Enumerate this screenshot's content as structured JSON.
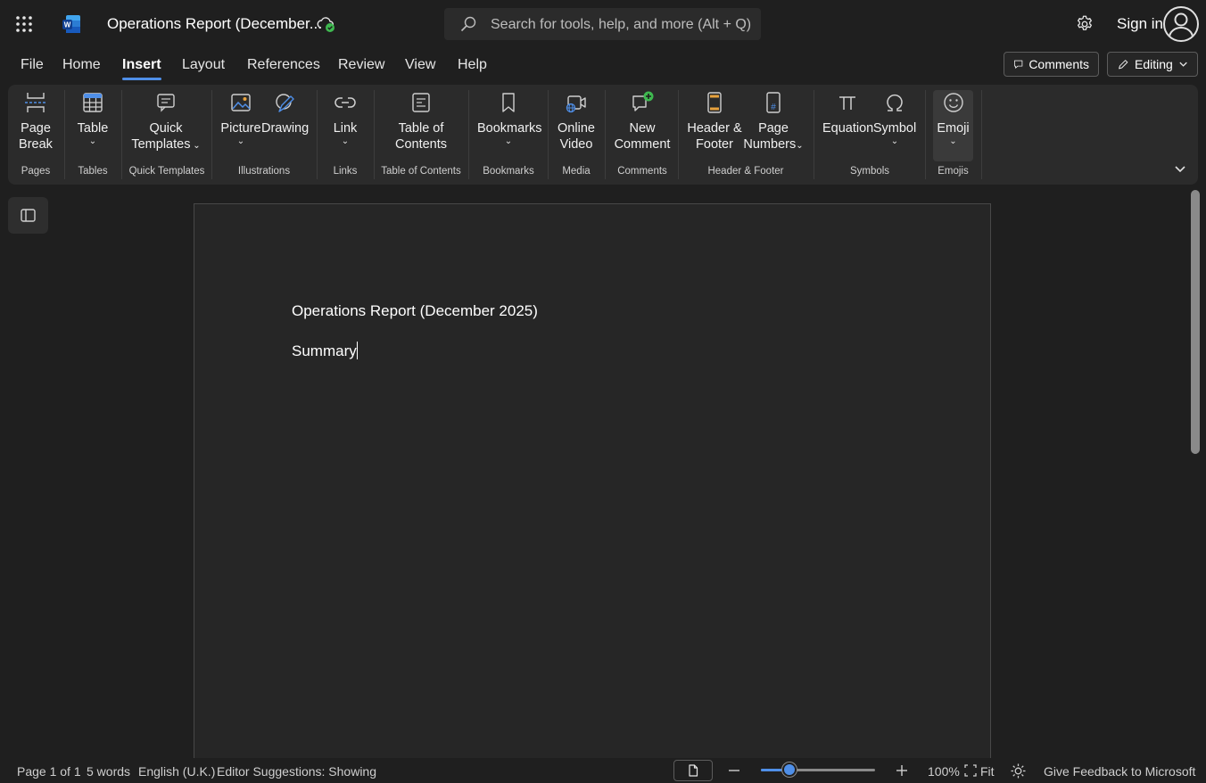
{
  "app": {
    "doc_title": "Operations Report (December...",
    "sign_in": "Sign in"
  },
  "search": {
    "placeholder": "Search for tools, help, and more (Alt + Q)"
  },
  "menu": {
    "tabs": [
      "File",
      "Home",
      "Insert",
      "Layout",
      "References",
      "Review",
      "View",
      "Help"
    ],
    "active": "Insert"
  },
  "actions": {
    "comments": "Comments",
    "editing": "Editing"
  },
  "ribbon": {
    "buttons": {
      "page_break": [
        "Page",
        "Break"
      ],
      "table": "Table",
      "quick_templates": [
        "Quick",
        "Templates"
      ],
      "picture": "Picture",
      "drawing": "Drawing",
      "link": "Link",
      "toc": [
        "Table of",
        "Contents"
      ],
      "bookmarks": "Bookmarks",
      "online_video": [
        "Online",
        "Video"
      ],
      "new_comment": [
        "New",
        "Comment"
      ],
      "header_footer": [
        "Header &",
        "Footer"
      ],
      "page_numbers": [
        "Page",
        "Numbers"
      ],
      "equation": "Equation",
      "symbol": "Symbol",
      "emoji": "Emoji"
    },
    "groups": {
      "pages": "Pages",
      "tables": "Tables",
      "quick_templates": "Quick Templates",
      "illustrations": "Illustrations",
      "links": "Links",
      "toc": "Table of Contents",
      "bookmarks": "Bookmarks",
      "media": "Media",
      "comments": "Comments",
      "header_footer": "Header & Footer",
      "symbols": "Symbols",
      "emojis": "Emojis"
    }
  },
  "document": {
    "line1": "Operations Report (December 2025)",
    "line2": "Summary"
  },
  "status": {
    "page": "Page 1 of 1",
    "words": "5 words",
    "language": "English (U.K.)",
    "editor": "Editor Suggestions: Showing",
    "zoom": "100%",
    "zoom_fraction": 0.25,
    "fit": "Fit",
    "feedback": "Give Feedback to Microsoft"
  },
  "colors": {
    "accent": "#4f8fe8",
    "background": "#1f1f1f",
    "ribbon": "#2b2b2b",
    "page": "#262626"
  }
}
